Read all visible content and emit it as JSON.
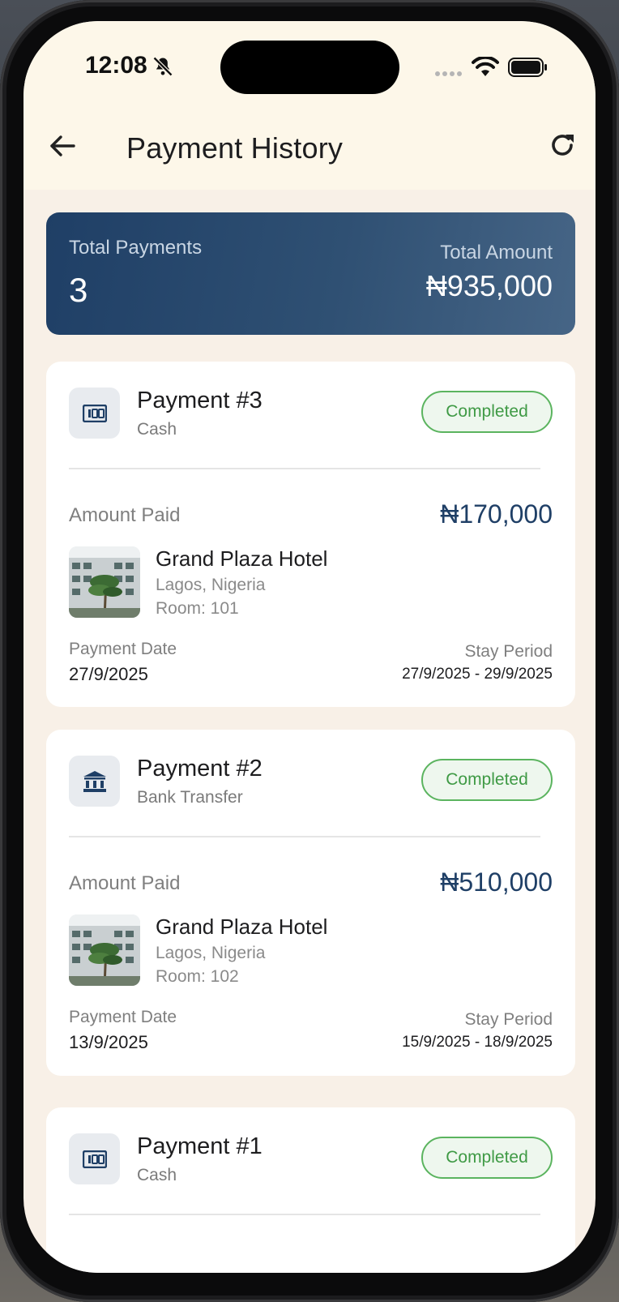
{
  "status_bar": {
    "time": "12:08"
  },
  "header": {
    "title": "Payment History"
  },
  "summary": {
    "total_payments_label": "Total Payments",
    "total_payments_value": "3",
    "total_amount_label": "Total Amount",
    "total_amount_value": "₦935,000"
  },
  "payments": [
    {
      "title": "Payment #3",
      "method": "Cash",
      "method_icon": "cash-icon",
      "status": "Completed",
      "amount_label": "Amount Paid",
      "amount": "₦170,000",
      "hotel": "Grand Plaza Hotel",
      "location": "Lagos, Nigeria",
      "room": "Room: 101",
      "payment_date_label": "Payment Date",
      "payment_date": "27/9/2025",
      "stay_period_label": "Stay Period",
      "stay_period": "27/9/2025 - 29/9/2025"
    },
    {
      "title": "Payment #2",
      "method": "Bank Transfer",
      "method_icon": "bank-icon",
      "status": "Completed",
      "amount_label": "Amount Paid",
      "amount": "₦510,000",
      "hotel": "Grand Plaza Hotel",
      "location": "Lagos, Nigeria",
      "room": "Room: 102",
      "payment_date_label": "Payment Date",
      "payment_date": "13/9/2025",
      "stay_period_label": "Stay Period",
      "stay_period": "15/9/2025 - 18/9/2025"
    },
    {
      "title": "Payment #1",
      "method": "Cash",
      "method_icon": "cash-icon",
      "status": "Completed"
    }
  ],
  "colors": {
    "accent": "#1f3f66",
    "status_green": "#3f9a45",
    "background": "#f8f0e7",
    "header_background": "#fdf7e9"
  }
}
